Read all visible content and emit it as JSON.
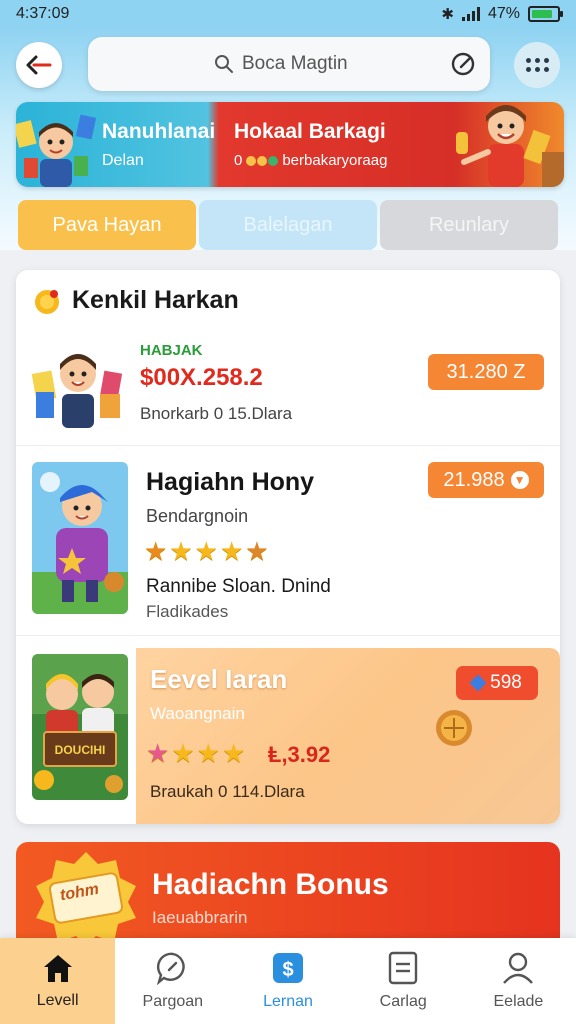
{
  "status_bar": {
    "time": "4:37:09",
    "battery": "47%",
    "battery_level": 0.85
  },
  "header": {
    "search": {
      "placeholder": "Boca Magtin"
    },
    "banner": {
      "left_title": "Nanuhlanai",
      "left_subtitle": "Delan",
      "right_title": "Hokaal Barkagi",
      "right_subtitle_prefix": "0",
      "right_subtitle": "berbakaryoraag"
    },
    "tabs": [
      {
        "label": "Pava Hayan"
      },
      {
        "label": "Balelagan"
      },
      {
        "label": "Reunlary"
      }
    ]
  },
  "card": {
    "title": "Kenkil Harkan",
    "items": [
      {
        "tag": "HABJAK",
        "price": "$00X.258.2",
        "meta": "Bnorkarb 0 15.Dlara",
        "pill": "31.280 Z"
      },
      {
        "name": "Hagiahn Hony",
        "sub": "Bendargnoin",
        "rating": 4,
        "line1": "Rannibe Sloan. Dnind",
        "line2": "Fladikades",
        "pill": "21.988"
      },
      {
        "name": "Eevel Iaran",
        "sub": "Waoangnain",
        "rating": 4,
        "price": "Ⱡ,3.92",
        "meta": "Braukah 0 114.Dlara",
        "pill": "598",
        "thumb_sign": "DOUCIHI"
      }
    ]
  },
  "bonus": {
    "title": "Hadiachn Bonus",
    "subtitle": "Iaeuabbrarin",
    "badge_text": "tohm"
  },
  "bottom_nav": [
    {
      "label": "Levell",
      "icon": "home-icon"
    },
    {
      "label": "Pargoan",
      "icon": "chat-bubble-icon"
    },
    {
      "label": "Lernan",
      "icon": "dollar-app-icon"
    },
    {
      "label": "Carlag",
      "icon": "document-icon"
    },
    {
      "label": "Eelade",
      "icon": "profile-icon"
    }
  ],
  "colors": {
    "header_blue": "#8fd3f2",
    "accent_orange": "#f58634",
    "price_red": "#e2291d",
    "tab_yellow": "#f9c04b",
    "bonus_red": "#e5331f",
    "nav_active": "#fcd08e"
  }
}
